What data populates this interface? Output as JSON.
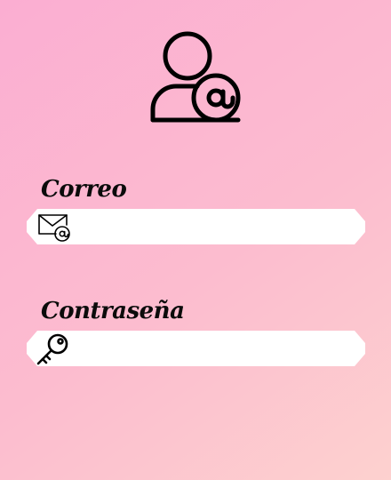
{
  "login": {
    "avatar_icon": "user-at-icon",
    "email": {
      "label": "Correo",
      "value": "",
      "icon": "mail-at-icon"
    },
    "password": {
      "label": "Contraseña",
      "value": "",
      "icon": "key-icon"
    }
  },
  "colors": {
    "background_start": "#fbaed2",
    "background_end": "#fdd1cf",
    "field": "#ffffff",
    "text": "#0b0b0b"
  }
}
